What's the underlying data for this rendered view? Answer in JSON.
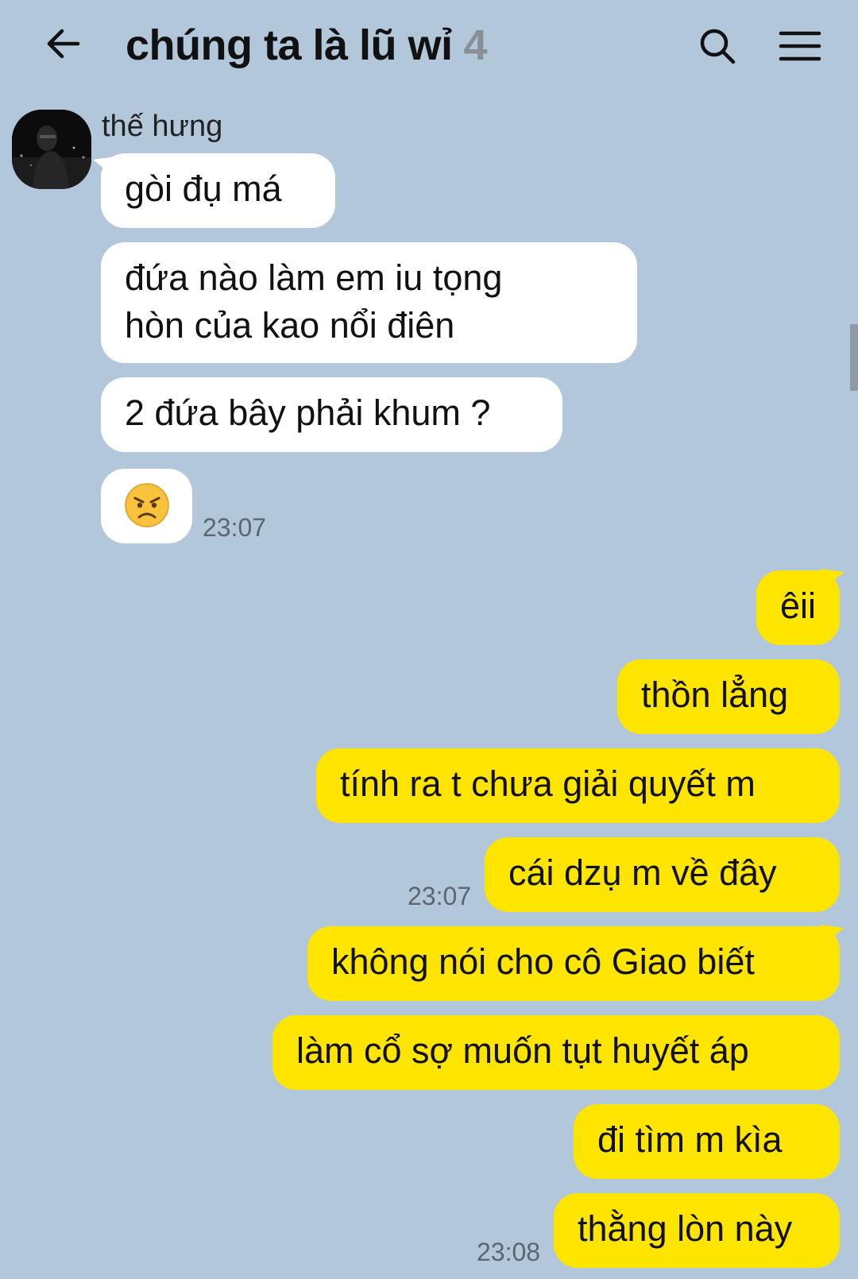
{
  "header": {
    "title": "chúng ta là lũ wỉ",
    "member_count": "4",
    "back_icon": "arrow-left-icon",
    "search_icon": "search-icon",
    "menu_icon": "hamburger-menu-icon"
  },
  "incoming": {
    "sender_name": "thế hưng",
    "messages": [
      "gòi đụ má",
      "đứa nào làm em iu tọng",
      "hòn của kao nổi điên",
      "2 đứa bây phải khum ?"
    ],
    "emoji": "😠",
    "time": "23:07"
  },
  "outgoing": {
    "messages": [
      "êii",
      "thồn lẳng",
      "tính ra t chưa giải quyết m",
      "cái dzụ m về đây",
      "không nói cho cô Giao biết",
      "làm cổ sợ muốn tụt huyết áp",
      "đi tìm m kìa",
      "thằng lòn này"
    ],
    "time_1": "23:07",
    "time_2": "23:08"
  },
  "colors": {
    "background": "#b2c7da",
    "incoming_bubble": "#ffffff",
    "outgoing_bubble": "#fee500"
  }
}
